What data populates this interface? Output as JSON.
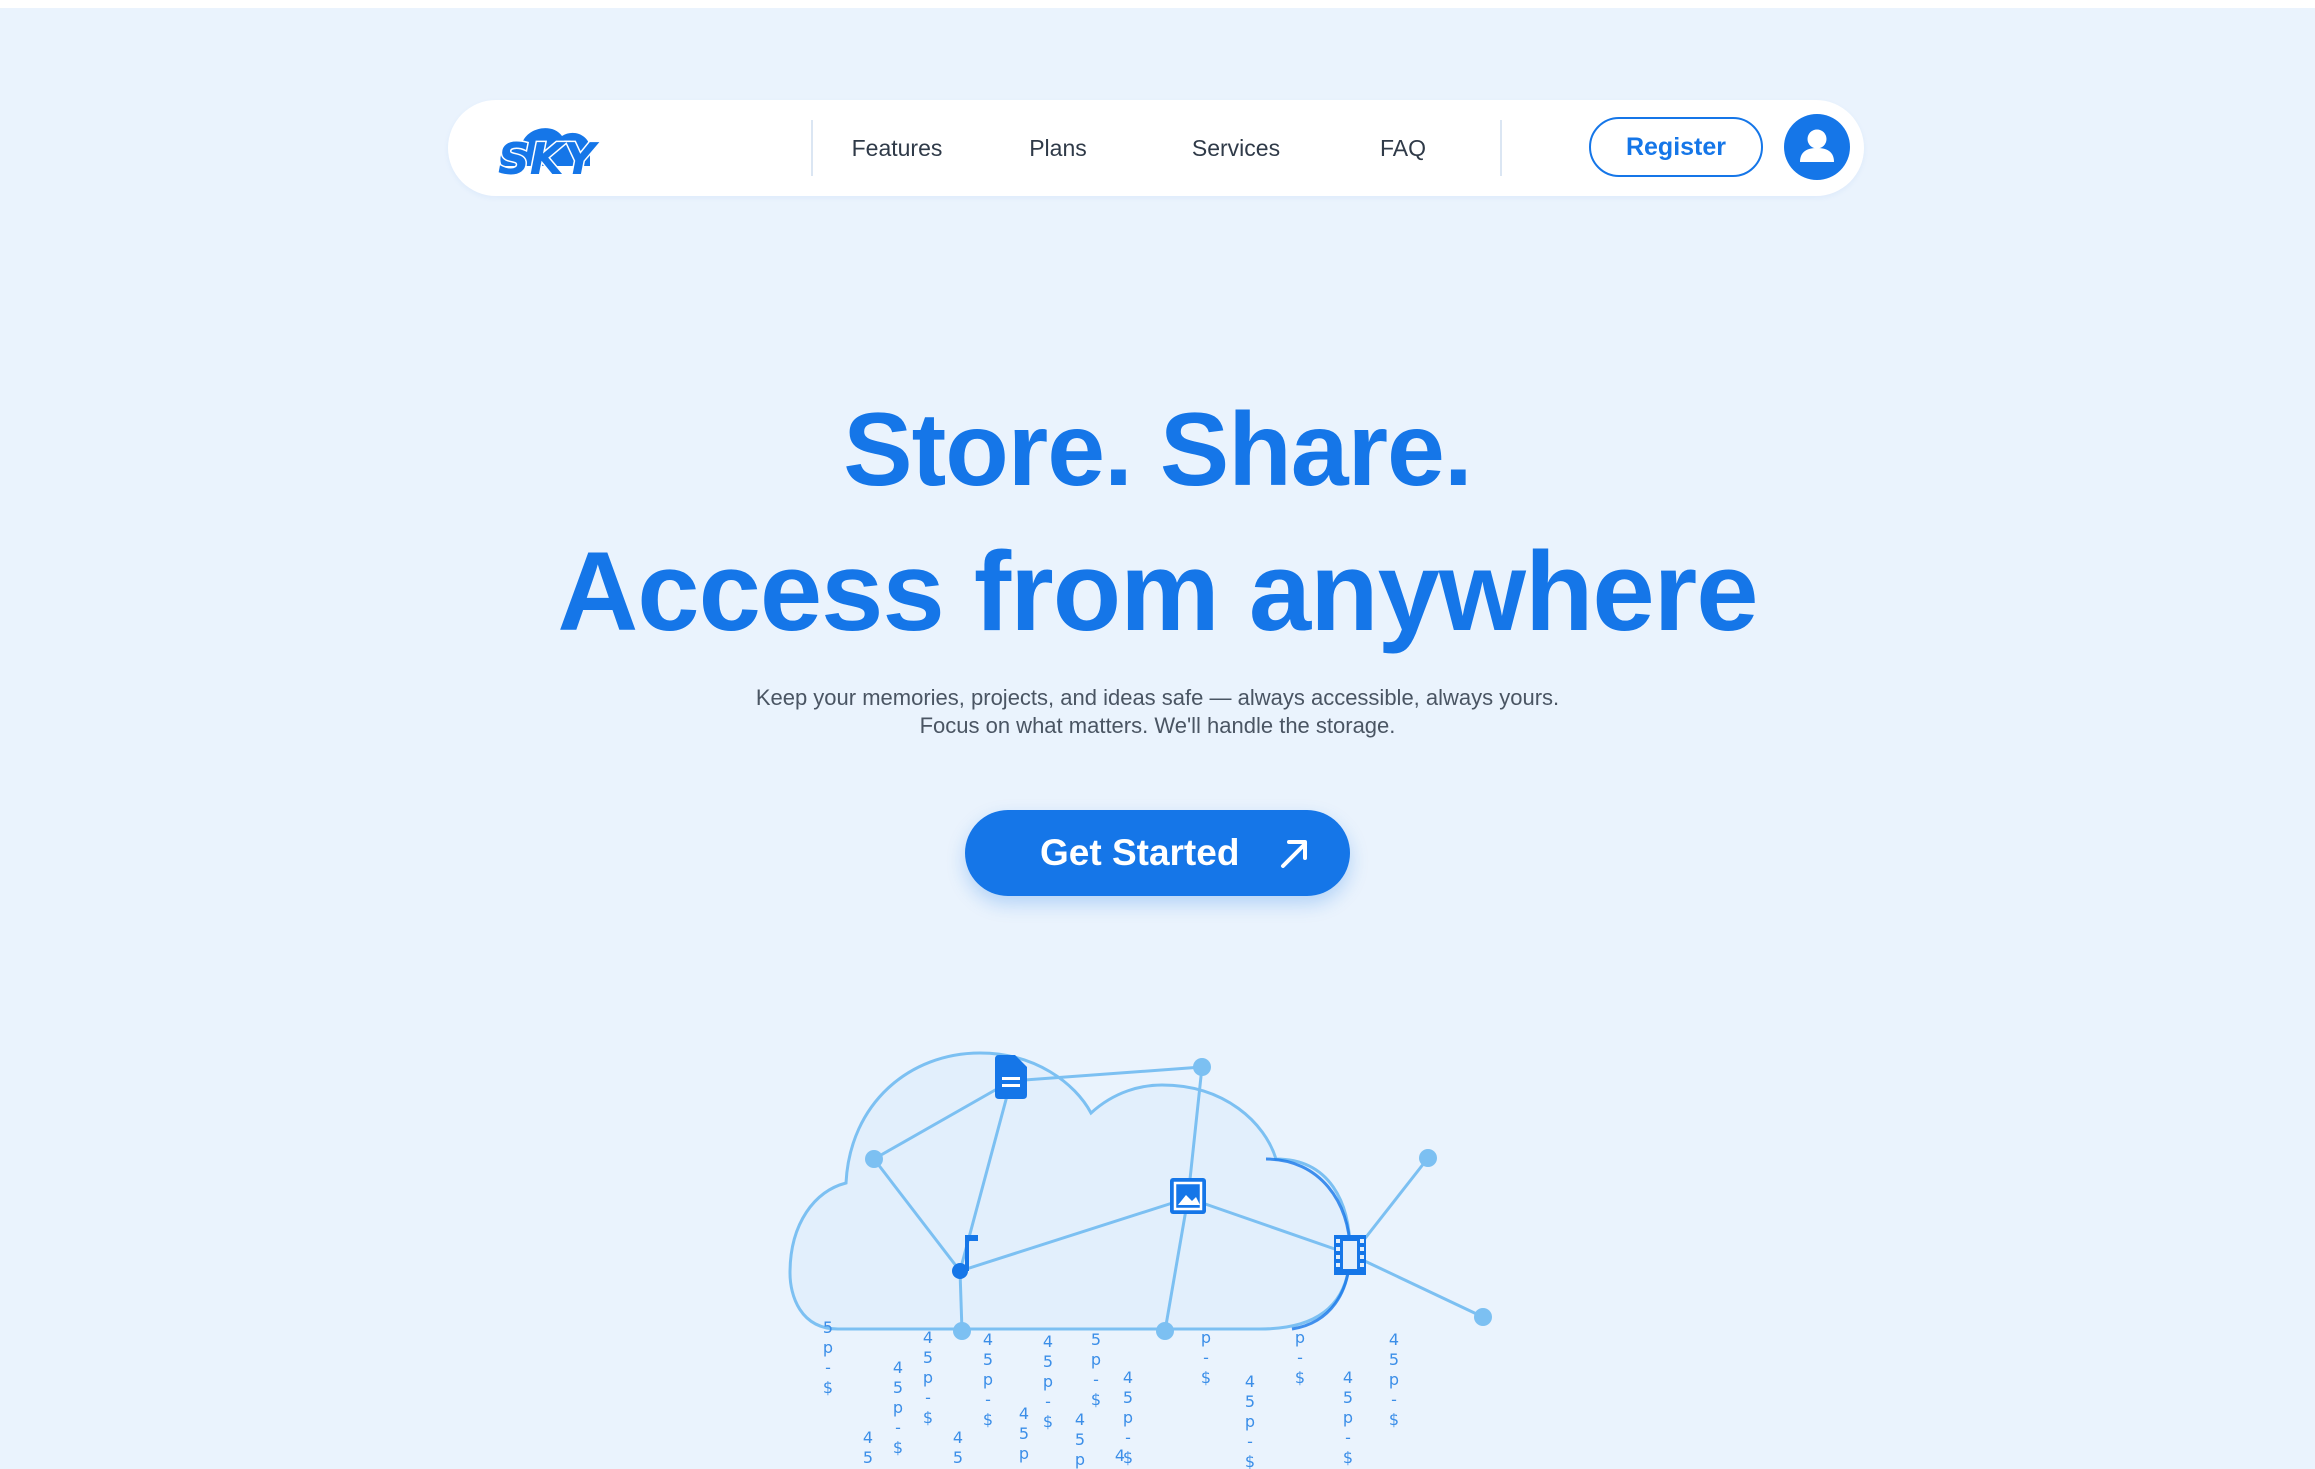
{
  "brand": {
    "logo_text": "SKY"
  },
  "nav": {
    "links": [
      {
        "label": "Features"
      },
      {
        "label": "Plans"
      },
      {
        "label": "Services"
      },
      {
        "label": "FAQ"
      }
    ],
    "register_label": "Register",
    "account_icon": "user-icon"
  },
  "hero": {
    "title_line1": "Store. Share.",
    "title_line2": "Access from anywhere",
    "subtitle_line1": "Keep your memories, projects, and ideas safe — always accessible, always yours.",
    "subtitle_line2": "Focus on what matters. We'll handle the storage.",
    "cta_label": "Get Started",
    "cta_icon": "arrow-up-right-icon"
  },
  "illustration": {
    "node_icons": [
      "document-icon",
      "image-icon",
      "music-note-icon",
      "film-icon"
    ],
    "rain_glyphs": [
      "4",
      "5",
      "p",
      "-",
      "$"
    ]
  },
  "colors": {
    "accent": "#1576e8",
    "background": "#eaf3fd",
    "cloud_line": "#7cc0f2",
    "heading": "#1576e8",
    "body_text": "#4a5563"
  }
}
